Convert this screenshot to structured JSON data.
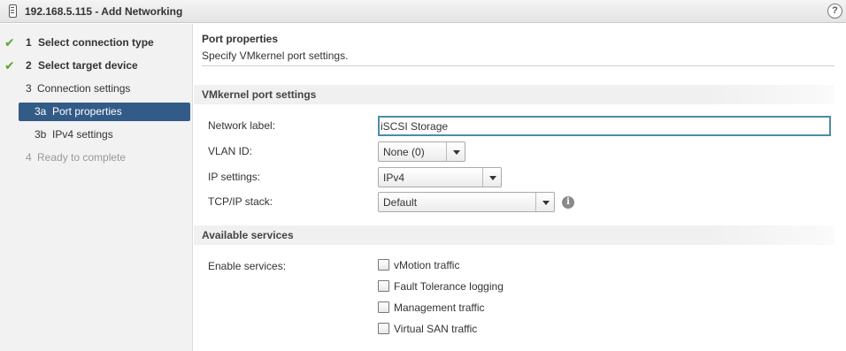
{
  "window": {
    "title": "192.168.5.115 - Add Networking",
    "help_glyph": "?"
  },
  "nav": {
    "steps": [
      {
        "num": "1",
        "label": "Select connection type",
        "status": "complete"
      },
      {
        "num": "2",
        "label": "Select target device",
        "status": "complete"
      },
      {
        "num": "3",
        "label": "Connection settings",
        "status": "in-progress"
      },
      {
        "num": "3a",
        "label": "Port properties",
        "status": "active"
      },
      {
        "num": "3b",
        "label": "IPv4 settings",
        "status": "pending"
      },
      {
        "num": "4",
        "label": "Ready to complete",
        "status": "disabled"
      }
    ],
    "check_glyph": "✔"
  },
  "page": {
    "title": "Port properties",
    "subtitle": "Specify VMkernel port settings."
  },
  "vmk_section": {
    "heading": "VMkernel port settings",
    "network_label": {
      "label": "Network label:",
      "value": "iSCSI Storage"
    },
    "vlan_id": {
      "label": "VLAN ID:",
      "selected": "None (0)"
    },
    "ip_settings": {
      "label": "IP settings:",
      "selected": "IPv4"
    },
    "tcpip_stack": {
      "label": "TCP/IP stack:",
      "selected": "Default",
      "info_glyph": "i"
    }
  },
  "services_section": {
    "heading": "Available services",
    "label": "Enable services:",
    "services": [
      {
        "label": "vMotion traffic",
        "checked": false
      },
      {
        "label": "Fault Tolerance logging",
        "checked": false
      },
      {
        "label": "Management traffic",
        "checked": false
      },
      {
        "label": "Virtual SAN traffic",
        "checked": false
      }
    ]
  },
  "colors": {
    "active_step_bg": "#325b87",
    "check_green": "#5aa630",
    "input_focus_border": "#4a8ea4"
  }
}
